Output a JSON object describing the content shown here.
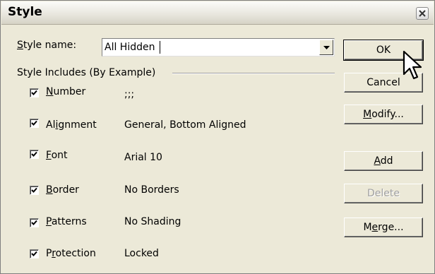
{
  "window": {
    "title": "Style"
  },
  "style_name": {
    "label_pre": "",
    "label_u": "S",
    "label_post": "tyle name:",
    "value": "All Hidden"
  },
  "group": {
    "label": "Style Includes (By Example)"
  },
  "options": [
    {
      "label_pre": "",
      "label_u": "N",
      "label_post": "umber",
      "value": ";;;",
      "checked": true
    },
    {
      "label_pre": "Al",
      "label_u": "i",
      "label_post": "gnment",
      "value": "General, Bottom Aligned",
      "checked": true
    },
    {
      "label_pre": "",
      "label_u": "F",
      "label_post": "ont",
      "value": "Arial 10",
      "checked": true
    },
    {
      "label_pre": "",
      "label_u": "B",
      "label_post": "order",
      "value": "No Borders",
      "checked": true
    },
    {
      "label_pre": "",
      "label_u": "P",
      "label_post": "atterns",
      "value": "No Shading",
      "checked": true
    },
    {
      "label_pre": "P",
      "label_u": "r",
      "label_post": "otection",
      "value": "Locked",
      "checked": true
    }
  ],
  "buttons": {
    "ok": "OK",
    "cancel": "Cancel",
    "modify": {
      "pre": "",
      "u": "M",
      "post": "odify..."
    },
    "add": {
      "pre": "",
      "u": "A",
      "post": "dd"
    },
    "delete": "Delete",
    "merge": {
      "pre": "M",
      "u": "e",
      "post": "rge..."
    }
  },
  "icons": {
    "close": "close-icon",
    "dropdown": "chevron-down-icon",
    "check": "checkmark-icon",
    "cursor": "mouse-pointer-icon"
  },
  "colors": {
    "dialog_bg": "#ece9d8",
    "disabled_text": "#a0a0a0"
  }
}
